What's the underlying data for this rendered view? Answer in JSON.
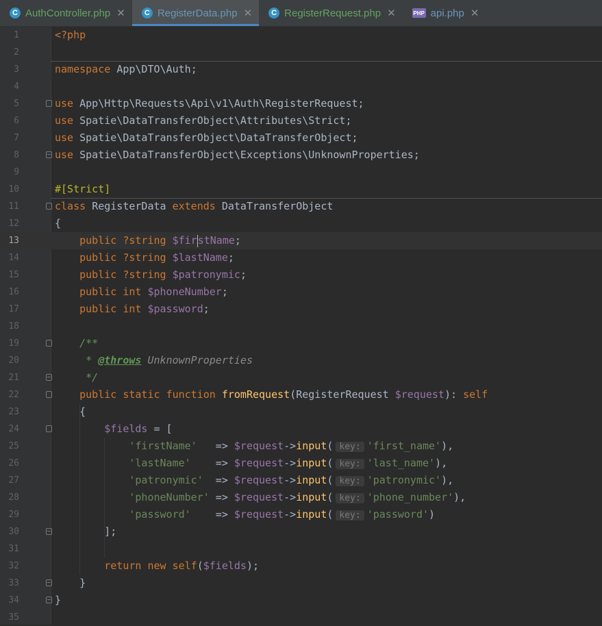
{
  "tabs": [
    {
      "label": "AuthController.php",
      "icon": "C",
      "icon_type": "class-icon",
      "active": false,
      "style": "green"
    },
    {
      "label": "RegisterData.php",
      "icon": "C",
      "icon_type": "class-icon",
      "active": true,
      "style": "modified"
    },
    {
      "label": "RegisterRequest.php",
      "icon": "C",
      "icon_type": "class-icon",
      "active": false,
      "style": "green"
    },
    {
      "label": "api.php",
      "icon": "PHP",
      "icon_type": "php-file-icon",
      "active": false,
      "style": "modified"
    }
  ],
  "close_glyph": "✕",
  "editor": {
    "current_line": 13,
    "lines": [
      {
        "n": "1",
        "code": [
          [
            "kw",
            "<?php"
          ]
        ]
      },
      {
        "n": "2",
        "code": []
      },
      {
        "n": "3",
        "code": [
          [
            "kw",
            "namespace "
          ],
          [
            "cls",
            "App\\DTO\\Auth"
          ],
          [
            "",
            ";"
          ]
        ]
      },
      {
        "n": "4",
        "code": []
      },
      {
        "n": "5",
        "fold": "start",
        "code": [
          [
            "kw",
            "use "
          ],
          [
            "cls",
            "App\\Http\\Requests\\Api\\v1\\Auth\\RegisterRequest"
          ],
          [
            "",
            ";"
          ]
        ]
      },
      {
        "n": "6",
        "code": [
          [
            "kw",
            "use "
          ],
          [
            "cls",
            "Spatie\\DataTransferObject\\Attributes\\Strict"
          ],
          [
            "",
            ";"
          ]
        ]
      },
      {
        "n": "7",
        "code": [
          [
            "kw",
            "use "
          ],
          [
            "cls",
            "Spatie\\DataTransferObject\\DataTransferObject"
          ],
          [
            "",
            ";"
          ]
        ]
      },
      {
        "n": "8",
        "fold": "end",
        "code": [
          [
            "kw",
            "use "
          ],
          [
            "cls",
            "Spatie\\DataTransferObject\\Exceptions\\UnknownProperties"
          ],
          [
            "",
            ";"
          ]
        ]
      },
      {
        "n": "9",
        "code": []
      },
      {
        "n": "10",
        "code": [
          [
            "attr",
            "#[Strict]"
          ]
        ]
      },
      {
        "n": "11",
        "fold": "start",
        "code": [
          [
            "kw",
            "class "
          ],
          [
            "cls",
            "RegisterData "
          ],
          [
            "kw",
            "extends "
          ],
          [
            "cls",
            "DataTransferObject"
          ]
        ]
      },
      {
        "n": "12",
        "code": [
          [
            "",
            "{"
          ]
        ]
      },
      {
        "n": "13",
        "code": [
          [
            "",
            "    "
          ],
          [
            "kw",
            "public "
          ],
          [
            "kw",
            "?string "
          ],
          [
            "var",
            "$fir"
          ],
          [
            "caret",
            ""
          ],
          [
            "var",
            "stName"
          ],
          [
            "",
            ";"
          ]
        ]
      },
      {
        "n": "14",
        "code": [
          [
            "",
            "    "
          ],
          [
            "kw",
            "public "
          ],
          [
            "kw",
            "?string "
          ],
          [
            "var",
            "$lastName"
          ],
          [
            "",
            ";"
          ]
        ]
      },
      {
        "n": "15",
        "code": [
          [
            "",
            "    "
          ],
          [
            "kw",
            "public "
          ],
          [
            "kw",
            "?string "
          ],
          [
            "var",
            "$patronymic"
          ],
          [
            "",
            ";"
          ]
        ]
      },
      {
        "n": "16",
        "code": [
          [
            "",
            "    "
          ],
          [
            "kw",
            "public "
          ],
          [
            "kw",
            "int "
          ],
          [
            "var",
            "$phoneNumber"
          ],
          [
            "",
            ";"
          ]
        ]
      },
      {
        "n": "17",
        "code": [
          [
            "",
            "    "
          ],
          [
            "kw",
            "public "
          ],
          [
            "kw",
            "int "
          ],
          [
            "var",
            "$password"
          ],
          [
            "",
            ";"
          ]
        ]
      },
      {
        "n": "18",
        "code": []
      },
      {
        "n": "19",
        "fold": "start",
        "code": [
          [
            "",
            "    "
          ],
          [
            "cmt",
            "/**"
          ]
        ]
      },
      {
        "n": "20",
        "code": [
          [
            "",
            "     "
          ],
          [
            "cmt",
            "* "
          ],
          [
            "tag",
            "@throws"
          ],
          [
            "cmt",
            " "
          ],
          [
            "cmtcls",
            "UnknownProperties"
          ]
        ]
      },
      {
        "n": "21",
        "fold": "end",
        "code": [
          [
            "",
            "     "
          ],
          [
            "cmt",
            "*/"
          ]
        ]
      },
      {
        "n": "22",
        "fold": "start",
        "code": [
          [
            "",
            "    "
          ],
          [
            "kw",
            "public "
          ],
          [
            "kw",
            "static "
          ],
          [
            "kw",
            "function "
          ],
          [
            "fn",
            "fromRequest"
          ],
          [
            "",
            "("
          ],
          [
            "cls",
            "RegisterRequest "
          ],
          [
            "var",
            "$request"
          ],
          [
            "",
            "): "
          ],
          [
            "kw",
            "self"
          ]
        ]
      },
      {
        "n": "23",
        "code": [
          [
            "",
            "    {"
          ]
        ]
      },
      {
        "n": "24",
        "fold": "start",
        "code": [
          [
            "",
            "        "
          ],
          [
            "var",
            "$fields"
          ],
          [
            "",
            " = ["
          ]
        ]
      },
      {
        "n": "25",
        "code": [
          [
            "",
            "            "
          ],
          [
            "str",
            "'firstName'"
          ],
          [
            "",
            "   => "
          ],
          [
            "var",
            "$request"
          ],
          [
            "",
            "->"
          ],
          [
            "fn",
            "input"
          ],
          [
            "",
            "("
          ],
          [
            "hint",
            "key:"
          ],
          [
            "str",
            "'first_name'"
          ],
          [
            "",
            "),"
          ]
        ]
      },
      {
        "n": "26",
        "code": [
          [
            "",
            "            "
          ],
          [
            "str",
            "'lastName'"
          ],
          [
            "",
            "    => "
          ],
          [
            "var",
            "$request"
          ],
          [
            "",
            "->"
          ],
          [
            "fn",
            "input"
          ],
          [
            "",
            "("
          ],
          [
            "hint",
            "key:"
          ],
          [
            "str",
            "'last_name'"
          ],
          [
            "",
            "),"
          ]
        ]
      },
      {
        "n": "27",
        "code": [
          [
            "",
            "            "
          ],
          [
            "str",
            "'patronymic'"
          ],
          [
            "",
            "  => "
          ],
          [
            "var",
            "$request"
          ],
          [
            "",
            "->"
          ],
          [
            "fn",
            "input"
          ],
          [
            "",
            "("
          ],
          [
            "hint",
            "key:"
          ],
          [
            "str",
            "'patronymic'"
          ],
          [
            "",
            "),"
          ]
        ]
      },
      {
        "n": "28",
        "code": [
          [
            "",
            "            "
          ],
          [
            "str",
            "'phoneNumber'"
          ],
          [
            "",
            " => "
          ],
          [
            "var",
            "$request"
          ],
          [
            "",
            "->"
          ],
          [
            "fn",
            "input"
          ],
          [
            "",
            "("
          ],
          [
            "hint",
            "key:"
          ],
          [
            "str",
            "'phone_number'"
          ],
          [
            "",
            "),"
          ]
        ]
      },
      {
        "n": "29",
        "code": [
          [
            "",
            "            "
          ],
          [
            "str",
            "'password'"
          ],
          [
            "",
            "    => "
          ],
          [
            "var",
            "$request"
          ],
          [
            "",
            "->"
          ],
          [
            "fn",
            "input"
          ],
          [
            "",
            "("
          ],
          [
            "hint",
            "key:"
          ],
          [
            "str",
            "'password'"
          ],
          [
            "",
            ")"
          ]
        ]
      },
      {
        "n": "30",
        "fold": "end",
        "code": [
          [
            "",
            "        ];"
          ]
        ]
      },
      {
        "n": "31",
        "code": []
      },
      {
        "n": "32",
        "code": [
          [
            "",
            "        "
          ],
          [
            "kw",
            "return "
          ],
          [
            "kw",
            "new "
          ],
          [
            "kw",
            "self"
          ],
          [
            "",
            "("
          ],
          [
            "var",
            "$fields"
          ],
          [
            "",
            ");"
          ]
        ]
      },
      {
        "n": "33",
        "fold": "end",
        "code": [
          [
            "",
            "    }"
          ]
        ]
      },
      {
        "n": "34",
        "fold": "end",
        "code": [
          [
            "",
            "}"
          ]
        ]
      },
      {
        "n": "35",
        "code": []
      }
    ]
  },
  "colors": {
    "background": "#2b2b2b",
    "keyword": "#cc7832",
    "variable": "#9876aa",
    "string": "#6a8759",
    "function": "#ffc66d",
    "comment": "#629755",
    "attribute": "#bbb529"
  }
}
